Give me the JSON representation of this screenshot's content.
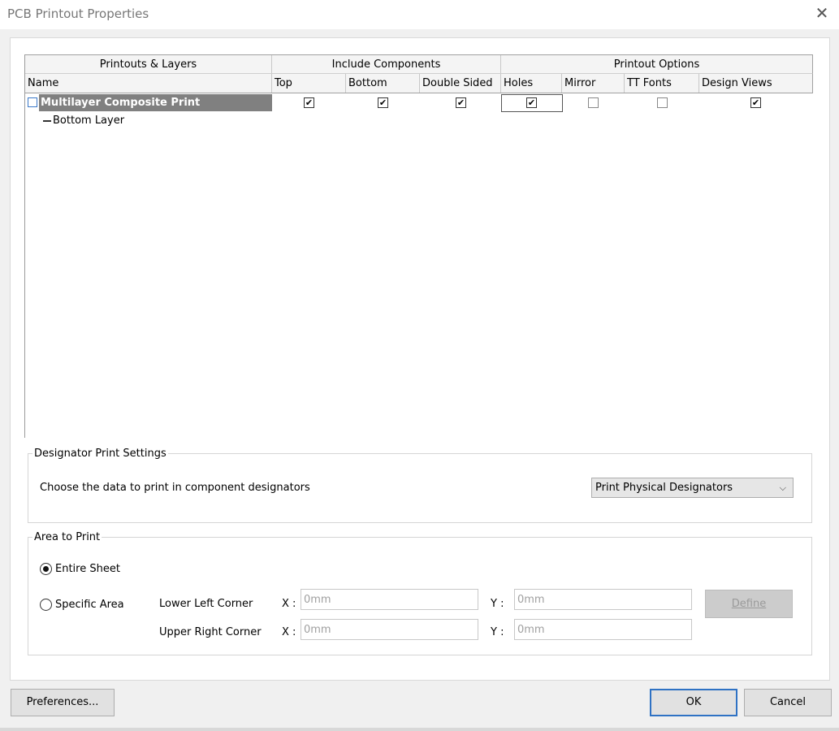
{
  "window": {
    "title": "PCB Printout Properties",
    "close_glyph": "✕"
  },
  "grid": {
    "group_headers": [
      "Printouts & Layers",
      "Include Components",
      "Printout Options"
    ],
    "columns": [
      "Name",
      "Top",
      "Bottom",
      "Double Sided",
      "Holes",
      "Mirror",
      "TT Fonts",
      "Design Views"
    ],
    "rows": [
      {
        "name": "Multilayer Composite Print",
        "top": true,
        "bottom": true,
        "double_sided": true,
        "holes": true,
        "mirror": false,
        "tt_fonts": false,
        "design_views": true
      },
      {
        "name": "Bottom Layer"
      }
    ],
    "check_glyph": "✔"
  },
  "designator": {
    "group_title": "Designator Print Settings",
    "prompt": "Choose the data to print in component designators",
    "selected": "Print Physical Designators",
    "chevron": "⌵"
  },
  "area": {
    "group_title": "Area to Print",
    "entire_sheet": "Entire Sheet",
    "specific_area": "Specific Area",
    "selected": "entire_sheet",
    "lower_left": "Lower Left Corner",
    "upper_right": "Upper Right Corner",
    "x_label": "X :",
    "y_label": "Y :",
    "ll_x": "0mm",
    "ll_y": "0mm",
    "ur_x": "0mm",
    "ur_y": "0mm",
    "define_label": "Define"
  },
  "footer": {
    "preferences_label": "Preferences...",
    "ok_label": "OK",
    "cancel_label": "Cancel"
  }
}
